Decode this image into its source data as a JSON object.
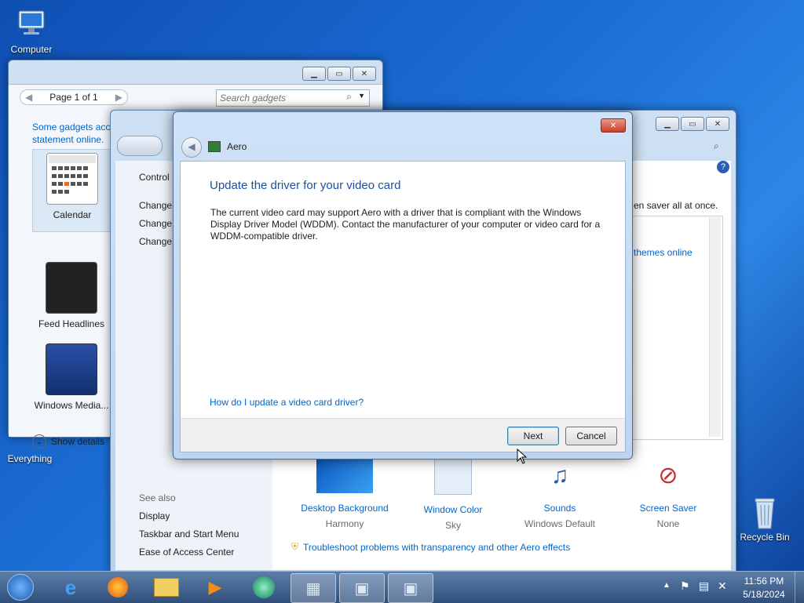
{
  "desktop": {
    "icons": [
      {
        "label": "Computer"
      },
      {
        "label": "Everything"
      },
      {
        "label": "Recycle Bin"
      }
    ]
  },
  "gadgets_window": {
    "page_label": "Page 1 of 1",
    "search_placeholder": "Search gadgets",
    "note": "Some gadgets acc statement online.",
    "items": [
      {
        "label": "Calendar"
      },
      {
        "label": "Feed Headlines"
      },
      {
        "label": "Windows Media..."
      }
    ],
    "show_details": "Show details"
  },
  "personalization_window": {
    "nav": {
      "control": "Control",
      "change1": "Change",
      "change2": "Change",
      "change3": "Change"
    },
    "right_text": "en saver all at once.",
    "themes_link": "themes online",
    "see_also": "See also",
    "see_also_links": [
      "Display",
      "Taskbar and Start Menu",
      "Ease of Access Center"
    ],
    "bottom_items": [
      {
        "title": "Desktop Background",
        "value": "Harmony"
      },
      {
        "title": "Window Color",
        "value": "Sky"
      },
      {
        "title": "Sounds",
        "value": "Windows Default"
      },
      {
        "title": "Screen Saver",
        "value": "None"
      }
    ],
    "troubleshoot": "Troubleshoot problems with transparency and other Aero effects"
  },
  "dialog": {
    "app_title": "Aero",
    "heading": "Update the driver for your video card",
    "body": "The current video card may support Aero with a driver that is compliant with the Windows Display Driver Model (WDDM).  Contact the manufacturer of your computer or video card for a WDDM-compatible driver.",
    "help_link": "How do I update a video card driver?",
    "next": "Next",
    "cancel": "Cancel"
  },
  "tray": {
    "time": "11:56 PM",
    "date": "5/18/2024"
  },
  "colors": {
    "accent": "#0066cc",
    "heading": "#1e4f9a"
  }
}
